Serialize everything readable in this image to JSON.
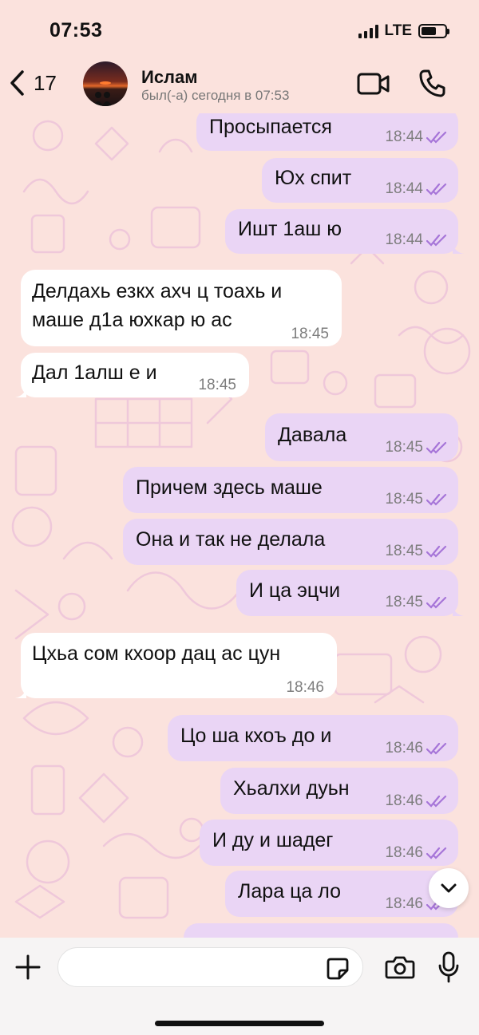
{
  "status_bar": {
    "time": "07:53",
    "network": "LTE",
    "battery_level": 0.65
  },
  "header": {
    "back_count": "17",
    "contact_name": "Ислам",
    "contact_status": "был(-а) сегодня в 07:53"
  },
  "messages": [
    {
      "dir": "out",
      "text": "Просыпается",
      "time": "18:44"
    },
    {
      "dir": "out",
      "text": "Юх спит",
      "time": "18:44"
    },
    {
      "dir": "out",
      "text": "Ишт 1аш ю",
      "time": "18:44"
    },
    {
      "dir": "in",
      "text_line1": "Делдахь езкх ахч ц тоахь и",
      "text_line2": "маше д1а юхкар ю ас",
      "time": "18:45"
    },
    {
      "dir": "in",
      "text": "Дал 1алш е и",
      "time": "18:45"
    },
    {
      "dir": "out",
      "text": "Давала",
      "time": "18:45"
    },
    {
      "dir": "out",
      "text": "Причем здесь маше",
      "time": "18:45"
    },
    {
      "dir": "out",
      "text": "Она и так не делала",
      "time": "18:45"
    },
    {
      "dir": "out",
      "text": "И ца эцчи",
      "time": "18:45"
    },
    {
      "dir": "in",
      "text": "Цхьа сом кхоор дац ас цун",
      "time": "18:46"
    },
    {
      "dir": "out",
      "text": "Цо ша кхоъ до и",
      "time": "18:46"
    },
    {
      "dir": "out",
      "text": "Хьалхи дуьн",
      "time": "18:46"
    },
    {
      "dir": "out",
      "text": "И ду и шадег",
      "time": "18:46"
    },
    {
      "dir": "out",
      "text": "Лара ца ло",
      "time": "18:46"
    }
  ],
  "composer": {
    "placeholder": ""
  },
  "colors": {
    "background": "#fbe2dd",
    "outgoing_bubble": "#ead5f5",
    "incoming_bubble": "#ffffff",
    "read_checks": "#a675d8"
  }
}
